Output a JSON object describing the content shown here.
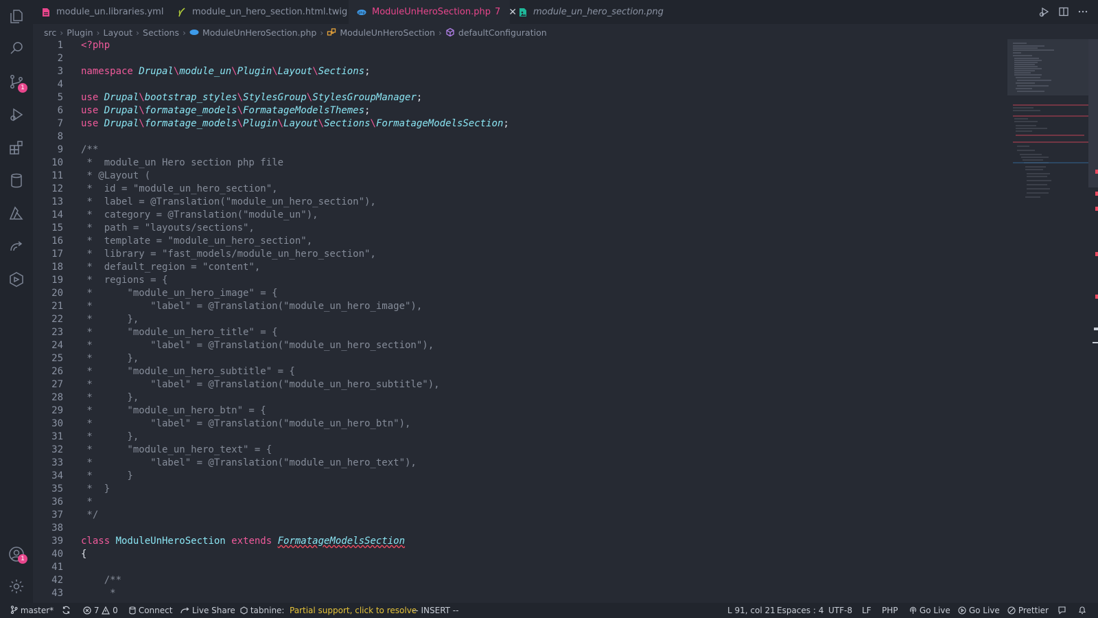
{
  "tabs": [
    {
      "label": "module_un.libraries.yml",
      "icon": "yaml-file-icon",
      "active": false,
      "italic": false
    },
    {
      "label": "module_un_hero_section.html.twig",
      "icon": "twig-file-icon",
      "active": false,
      "italic": false
    },
    {
      "label": "ModuleUnHeroSection.php",
      "badge": "7",
      "icon": "php-file-icon",
      "active": true,
      "italic": false
    },
    {
      "label": "module_un_hero_section.png",
      "icon": "image-file-icon",
      "active": false,
      "italic": true
    }
  ],
  "breadcrumb": [
    "src",
    "Plugin",
    "Layout",
    "Sections",
    "ModuleUnHeroSection.php",
    "ModuleUnHeroSection",
    "defaultConfiguration"
  ],
  "activity_badges": {
    "source_control": "1",
    "accounts": "1"
  },
  "code_lines": [
    [
      [
        "kw",
        "<?php"
      ]
    ],
    [],
    [
      [
        "kw",
        "namespace "
      ],
      [
        "cls",
        "Drupal"
      ],
      [
        "bslash",
        "\\"
      ],
      [
        "cls",
        "module_un"
      ],
      [
        "bslash",
        "\\"
      ],
      [
        "cls",
        "Plugin"
      ],
      [
        "bslash",
        "\\"
      ],
      [
        "cls",
        "Layout"
      ],
      [
        "bslash",
        "\\"
      ],
      [
        "cls",
        "Sections"
      ],
      [
        "plain",
        ";"
      ]
    ],
    [],
    [
      [
        "kw",
        "use "
      ],
      [
        "cls",
        "Drupal"
      ],
      [
        "bslash",
        "\\"
      ],
      [
        "cls",
        "bootstrap_styles"
      ],
      [
        "bslash",
        "\\"
      ],
      [
        "cls",
        "StylesGroup"
      ],
      [
        "bslash",
        "\\"
      ],
      [
        "cls",
        "StylesGroupManager"
      ],
      [
        "plain",
        ";"
      ]
    ],
    [
      [
        "kw",
        "use "
      ],
      [
        "cls",
        "Drupal"
      ],
      [
        "bslash",
        "\\"
      ],
      [
        "cls",
        "formatage_models"
      ],
      [
        "bslash",
        "\\"
      ],
      [
        "cls",
        "FormatageModelsThemes"
      ],
      [
        "plain",
        ";"
      ]
    ],
    [
      [
        "kw",
        "use "
      ],
      [
        "cls",
        "Drupal"
      ],
      [
        "bslash",
        "\\"
      ],
      [
        "cls",
        "formatage_models"
      ],
      [
        "bslash",
        "\\"
      ],
      [
        "cls",
        "Plugin"
      ],
      [
        "bslash",
        "\\"
      ],
      [
        "cls",
        "Layout"
      ],
      [
        "bslash",
        "\\"
      ],
      [
        "cls",
        "Sections"
      ],
      [
        "bslash",
        "\\"
      ],
      [
        "cls",
        "FormatageModelsSection"
      ],
      [
        "plain",
        ";"
      ]
    ],
    [],
    [
      [
        "cmt",
        "/**"
      ]
    ],
    [
      [
        "cmt",
        " *  module_un Hero section php file"
      ]
    ],
    [
      [
        "cmt",
        " * @Layout ("
      ]
    ],
    [
      [
        "cmt",
        " *  id = \"module_un_hero_section\","
      ]
    ],
    [
      [
        "cmt",
        " *  label = @Translation(\"module_un_hero_section\"),"
      ]
    ],
    [
      [
        "cmt",
        " *  category = @Translation(\"module_un\"),"
      ]
    ],
    [
      [
        "cmt",
        " *  path = \"layouts/sections\","
      ]
    ],
    [
      [
        "cmt",
        " *  template = \"module_un_hero_section\","
      ]
    ],
    [
      [
        "cmt",
        " *  library = \"fast_models/module_un_hero_section\","
      ]
    ],
    [
      [
        "cmt",
        " *  default_region = \"content\","
      ]
    ],
    [
      [
        "cmt",
        " *  regions = {"
      ]
    ],
    [
      [
        "cmt",
        " *      \"module_un_hero_image\" = {"
      ]
    ],
    [
      [
        "cmt",
        " *          \"label\" = @Translation(\"module_un_hero_image\"),"
      ]
    ],
    [
      [
        "cmt",
        " *      },"
      ]
    ],
    [
      [
        "cmt",
        " *      \"module_un_hero_title\" = {"
      ]
    ],
    [
      [
        "cmt",
        " *          \"label\" = @Translation(\"module_un_hero_section\"),"
      ]
    ],
    [
      [
        "cmt",
        " *      },"
      ]
    ],
    [
      [
        "cmt",
        " *      \"module_un_hero_subtitle\" = {"
      ]
    ],
    [
      [
        "cmt",
        " *          \"label\" = @Translation(\"module_un_hero_subtitle\"),"
      ]
    ],
    [
      [
        "cmt",
        " *      },"
      ]
    ],
    [
      [
        "cmt",
        " *      \"module_un_hero_btn\" = {"
      ]
    ],
    [
      [
        "cmt",
        " *          \"label\" = @Translation(\"module_un_hero_btn\"),"
      ]
    ],
    [
      [
        "cmt",
        " *      },"
      ]
    ],
    [
      [
        "cmt",
        " *      \"module_un_hero_text\" = {"
      ]
    ],
    [
      [
        "cmt",
        " *          \"label\" = @Translation(\"module_un_hero_text\"),"
      ]
    ],
    [
      [
        "cmt",
        " *      }"
      ]
    ],
    [
      [
        "cmt",
        " *  }"
      ]
    ],
    [
      [
        "cmt",
        " *"
      ]
    ],
    [
      [
        "cmt",
        " */"
      ]
    ],
    [],
    [
      [
        "kw",
        "class "
      ],
      [
        "cls-plain",
        "ModuleUnHeroSection"
      ],
      [
        "kw",
        " extends "
      ],
      [
        "cls-squig",
        "FormatageModelsSection"
      ]
    ],
    [
      [
        "plain",
        "{"
      ]
    ],
    [],
    [
      [
        "cmt",
        "    /**"
      ]
    ],
    [
      [
        "cmt",
        "     *"
      ]
    ]
  ],
  "status": {
    "branch": "master*",
    "errors": "7",
    "warnings": "0",
    "connect": "Connect",
    "live_share": "Live Share",
    "tabnine": "tabnine:",
    "partial_support": "Partial support, click to resolve",
    "mode": "-- INSERT --",
    "position": "L 91, col 21",
    "spaces": "Espaces : 4",
    "encoding": "UTF-8",
    "eol": "LF",
    "language": "PHP",
    "go_live_1": "Go Live",
    "go_live_2": "Go Live",
    "prettier": "Prettier"
  },
  "colors": {
    "accent": "#e8468c",
    "bg": "#262a33",
    "sidebar": "#21252d",
    "warning": "#e6c43a"
  }
}
